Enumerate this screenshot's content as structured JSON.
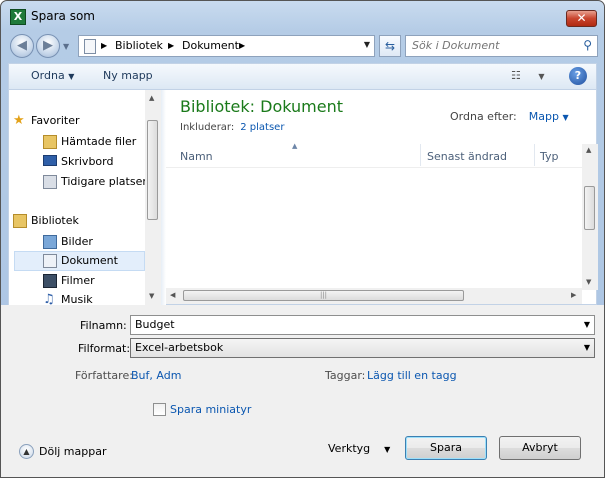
{
  "window": {
    "title": "Spara som",
    "app_icon_letter": "X",
    "close_symbol": "✕"
  },
  "address": {
    "breadcrumbs": [
      "Bibliotek",
      "Dokument"
    ],
    "search_placeholder": "Sök i Dokument"
  },
  "toolbar": {
    "organize_label": "Ordna",
    "new_folder_label": "Ny mapp",
    "help_symbol": "?"
  },
  "sidebar": {
    "favorites_label": "Favoriter",
    "favorites": [
      "Hämtade filer",
      "Skrivbord",
      "Tidigare platser"
    ],
    "libraries_label": "Bibliotek",
    "libraries": [
      "Bilder",
      "Dokument",
      "Filmer",
      "Musik"
    ],
    "selected": "Dokument"
  },
  "library": {
    "title": "Bibliotek: Dokument",
    "includes_label": "Inkluderar:",
    "includes_link": "2 platser",
    "arrange_label": "Ordna efter:",
    "arrange_value": "Mapp",
    "columns": [
      "Namn",
      "Senast ändrad",
      "Typ"
    ]
  },
  "form": {
    "filename_label": "Filnamn:",
    "filename_value": "Budget",
    "filetype_label": "Filformat:",
    "filetype_value": "Excel-arbetsbok",
    "authors_label": "Författare:",
    "authors_value": "Buf, Adm",
    "tags_label": "Taggar:",
    "tags_value": "Lägg till en tagg",
    "thumbnail_label": "Spara miniatyr",
    "thumbnail_checked": false
  },
  "footer": {
    "hide_folders_label": "Dölj mappar",
    "tools_label": "Verktyg",
    "save_label": "Spara",
    "cancel_label": "Avbryt"
  }
}
